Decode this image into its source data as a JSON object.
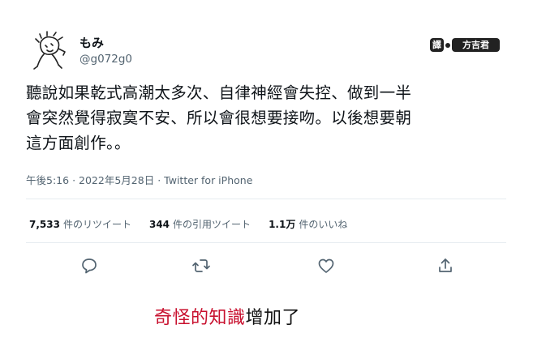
{
  "user": {
    "display_name": "もみ",
    "handle": "@g072g0",
    "avatar_icon": "doodle-character-avatar-icon"
  },
  "watermark": {
    "label_1": "譯",
    "label_2": "方吉君"
  },
  "tweet": {
    "text": "聽說如果乾式高潮太多次、自律神經會失控、做到一半\n會突然覺得寂寞不安、所以會很想要接吻。以後想要朝\n這方面創作。。",
    "time": "午後5:16",
    "date": "2022年5月28日",
    "separator": "·",
    "source": "Twitter for iPhone"
  },
  "stats": [
    {
      "num": "7,533",
      "label": "件のリツイート"
    },
    {
      "num": "344",
      "label": "件の引用ツイート"
    },
    {
      "num": "1.1万",
      "label": "件のいいね"
    }
  ],
  "actions": [
    {
      "name": "reply-icon"
    },
    {
      "name": "retweet-icon"
    },
    {
      "name": "like-icon"
    },
    {
      "name": "share-icon"
    }
  ],
  "caption": {
    "red": "奇怪的知識",
    "black": "增加了"
  },
  "colors": {
    "text": "#0f1419",
    "secondary": "#536471",
    "divider": "#e6ecf0",
    "caption_red": "#c8102e"
  }
}
